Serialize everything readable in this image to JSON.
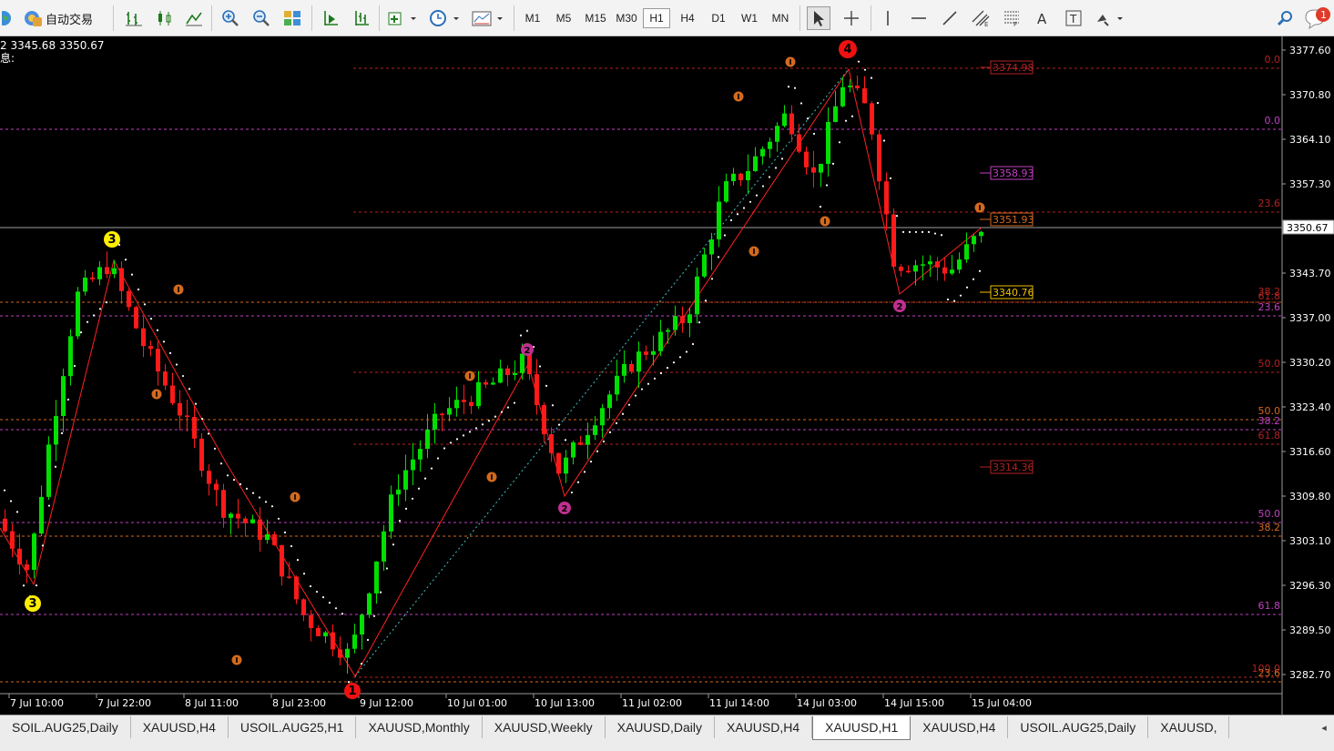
{
  "toolbar": {
    "auto_trading_label": "自动交易",
    "timeframes": [
      "M1",
      "M5",
      "M15",
      "M30",
      "H1",
      "H4",
      "D1",
      "W1",
      "MN"
    ],
    "active_timeframe": "H1",
    "notification_count": "1"
  },
  "chart": {
    "info_line1": "2 3345.68 3350.67",
    "info_line2": "息:",
    "current_price": "3350.67",
    "price_axis": [
      "3377.60",
      "3370.80",
      "3364.10",
      "3357.30",
      "3350.67",
      "3343.70",
      "3337.00",
      "3330.20",
      "3323.40",
      "3316.60",
      "3309.80",
      "3303.10",
      "3296.30",
      "3289.50",
      "3282.70"
    ],
    "time_axis": [
      "7 Jul 10:00",
      "7 Jul 22:00",
      "8 Jul 11:00",
      "8 Jul 23:00",
      "9 Jul 12:00",
      "10 Jul 01:00",
      "10 Jul 13:00",
      "11 Jul 02:00",
      "11 Jul 14:00",
      "14 Jul 03:00",
      "14 Jul 15:00",
      "15 Jul 04:00"
    ],
    "fib_labels": [
      "0.0",
      "0.0",
      "23.6",
      "38.2",
      "61.8",
      "23.6",
      "50.0",
      "50.0",
      "38.2",
      "61.8",
      "50.0",
      "38.2",
      "61.8",
      "100.0",
      "23.6"
    ],
    "price_boxes": [
      "3374.98",
      "3358.93",
      "3351.93",
      "3340.76",
      "3314.36"
    ],
    "wave_labels": [
      "3",
      "3",
      "4",
      "2",
      "2",
      "2",
      "1"
    ],
    "colors": {
      "background": "#000000",
      "bull": "#00e000",
      "bear": "#ff1a1a",
      "fib_red": "#b22222",
      "fib_magenta": "#c040c0",
      "fib_orange": "#d2691e"
    }
  },
  "tabs": [
    "SOIL.AUG25,Daily",
    "XAUUSD,H4",
    "USOIL.AUG25,H1",
    "XAUUSD,Monthly",
    "XAUUSD,Weekly",
    "XAUUSD,Daily",
    "XAUUSD,H4",
    "XAUUSD,H1",
    "XAUUSD,H4",
    "USOIL.AUG25,Daily",
    "XAUUSD,"
  ],
  "active_tab": "XAUUSD,H1",
  "tabs_scroll": "◂"
}
